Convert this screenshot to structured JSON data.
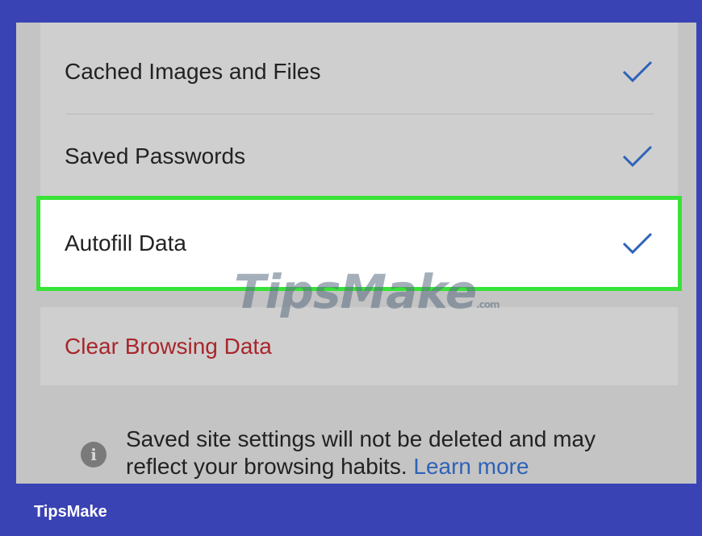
{
  "settings": {
    "items": [
      {
        "label": "Cached Images and Files",
        "checked": true
      },
      {
        "label": "Saved Passwords",
        "checked": true
      },
      {
        "label": "Autofill Data",
        "checked": true
      }
    ],
    "clear_button": "Clear Browsing Data",
    "info_text": "Saved site settings will not be deleted and may reflect your browsing habits.",
    "learn_more": "Learn more"
  },
  "watermark": {
    "text": "TipsMake",
    "suffix": ".com"
  },
  "brand": {
    "text": "TipsMake"
  },
  "colors": {
    "check": "#2e62b8",
    "highlight_border": "#38e238",
    "clear_text": "#a8262b",
    "frame": "#3a43b4"
  },
  "icons": {
    "check": "check-icon",
    "info": "info-icon"
  }
}
